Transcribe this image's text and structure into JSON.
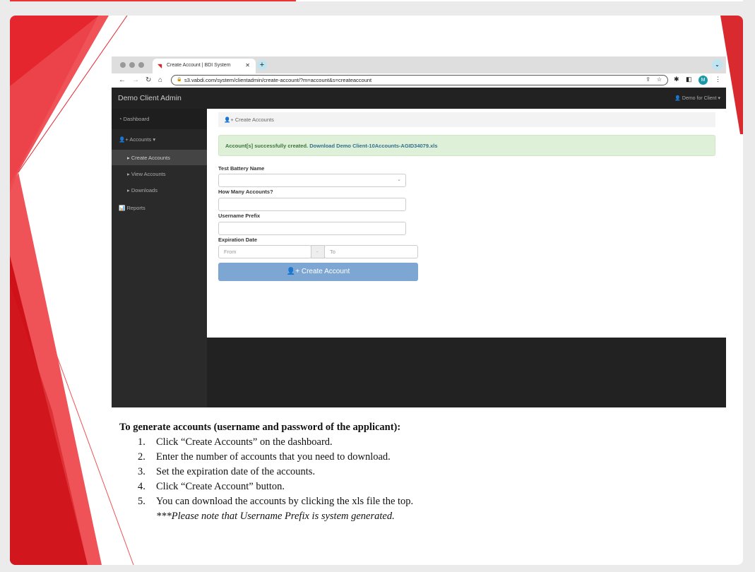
{
  "browser": {
    "tab_title": "Create Account | BDI System",
    "url": "s3.vabdi.com/system/clientadmin/create-account/?m=account&s=createaccount",
    "profile_initial": "M"
  },
  "app": {
    "brand": "Demo Client Admin",
    "user_menu": "Demo for Client",
    "sidebar": [
      {
        "label": "Dashboard",
        "icon": "dashboard-icon"
      },
      {
        "label": "Accounts",
        "icon": "user-plus-icon"
      },
      {
        "label": "Create Accounts"
      },
      {
        "label": "View Accounts"
      },
      {
        "label": "Downloads"
      },
      {
        "label": "Reports",
        "icon": "bar-chart-icon"
      }
    ],
    "breadcrumb": "Create Accounts",
    "alert_text": "Account[s] successfully created.",
    "alert_link": "Download Demo Client-10Accounts-AGID34079.xls",
    "form": {
      "battery_label": "Test Battery Name",
      "battery_value": "",
      "count_label": "How Many Accounts?",
      "count_value": "",
      "prefix_label": "Username Prefix",
      "prefix_value": "",
      "expiration_label": "Expiration Date",
      "from_placeholder": "From",
      "separator": "-",
      "to_placeholder": "To",
      "submit": "Create Account"
    }
  },
  "caption": {
    "heading": "To generate accounts (username and password of the applicant):",
    "steps": [
      {
        "n": "1.",
        "text": " Click “Create Accounts” on the dashboard."
      },
      {
        "n": "2.",
        "text": "Enter the number of accounts that you need to download."
      },
      {
        "n": "3.",
        "text": "Set the expiration date of the accounts."
      },
      {
        "n": "4.",
        "text": "Click “Create Account” button."
      },
      {
        "n": "5.",
        "text": "You can download the accounts by clicking the xls file the top."
      }
    ],
    "note": "***Please note that Username Prefix is system generated."
  },
  "colors": {
    "accent_red": "#e52630",
    "button": "#7ea6d3",
    "alert_bg": "#dff0d8"
  }
}
